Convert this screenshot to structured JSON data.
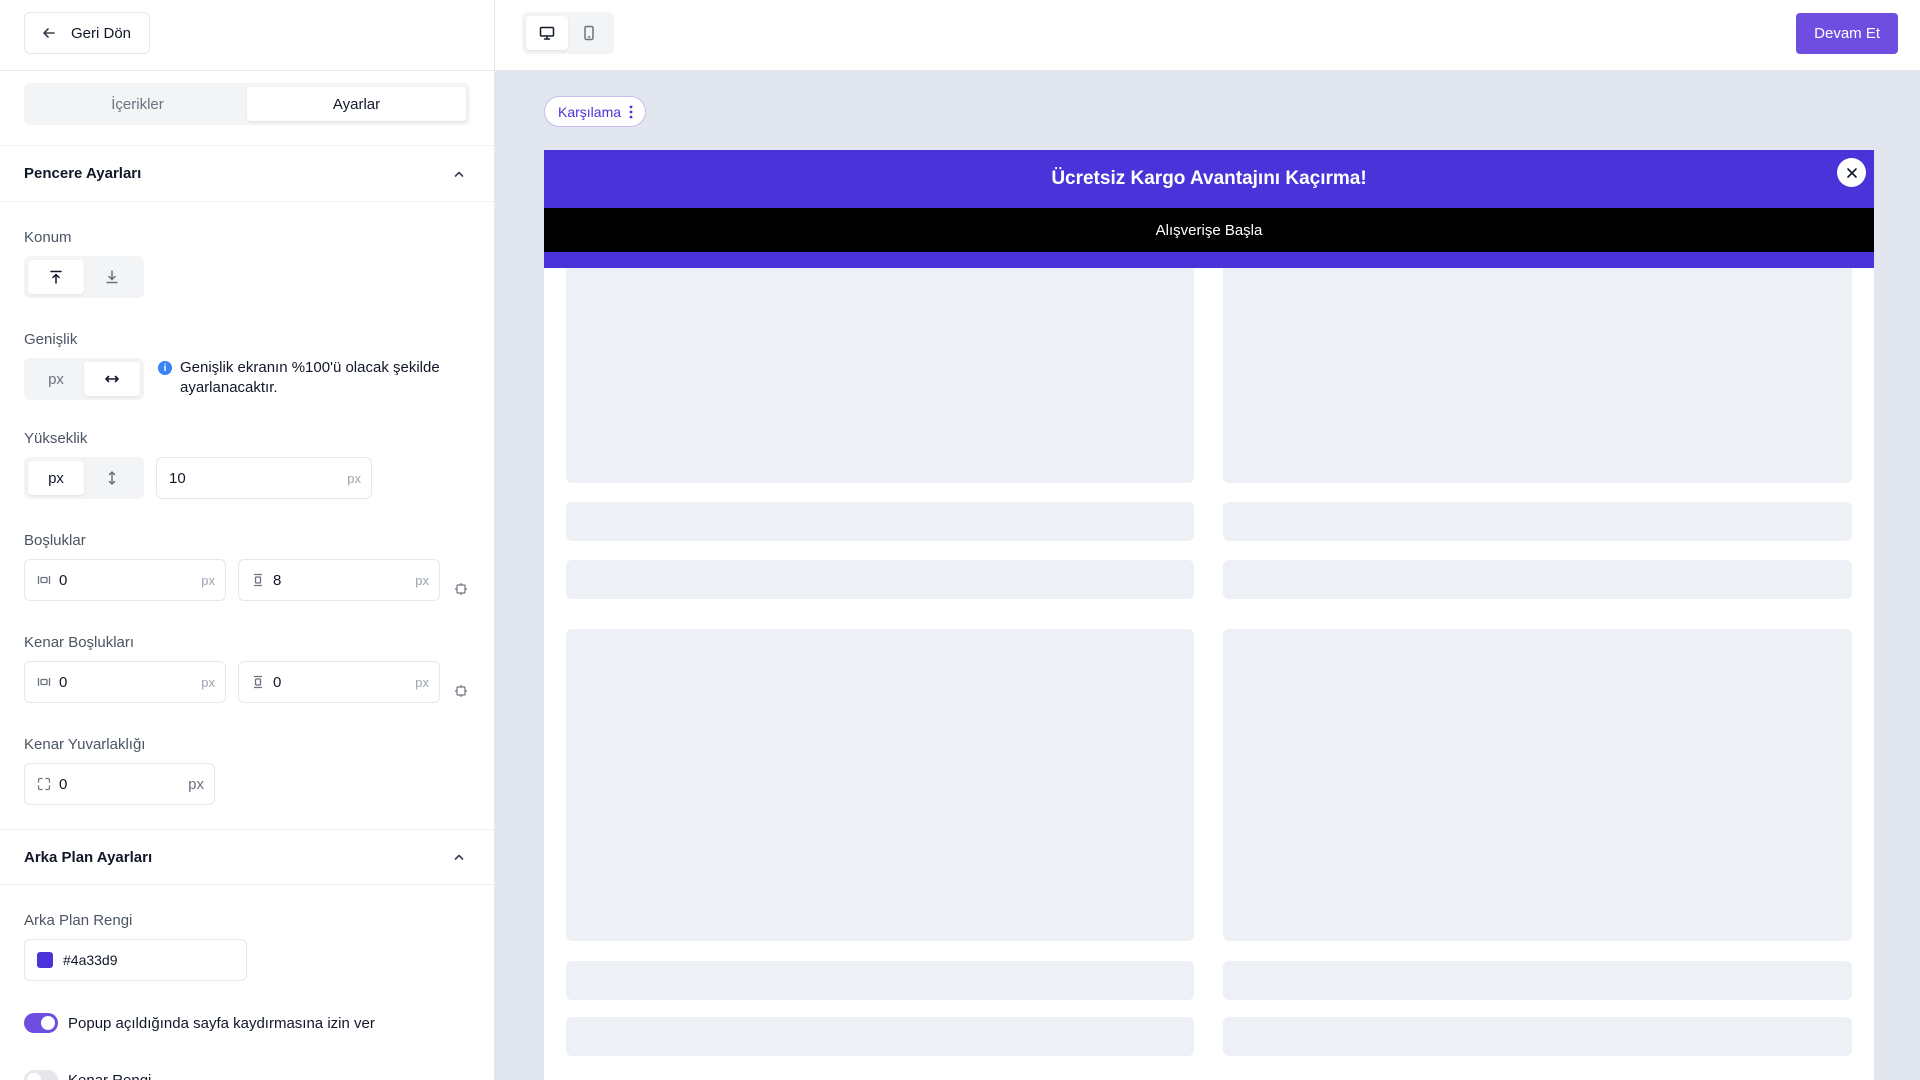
{
  "sidebar": {
    "back_label": "Geri Dön",
    "tabs": [
      {
        "label": "İçerikler",
        "active": false
      },
      {
        "label": "Ayarlar",
        "active": true
      }
    ],
    "window_settings": {
      "title": "Pencere Ayarları",
      "position": {
        "label": "Konum",
        "options": [
          "align-top-icon",
          "align-bottom-icon"
        ],
        "selected": 0
      },
      "width": {
        "label": "Genişlik",
        "options": [
          "px",
          "full-width-icon"
        ],
        "selected": 1,
        "info": "Genişlik ekranın %100'ü olacak şekilde ayarlanacaktır."
      },
      "height": {
        "label": "Yükseklik",
        "options": [
          "px",
          "auto-height-icon"
        ],
        "selected": 0,
        "value": "10",
        "unit": "px"
      },
      "padding": {
        "label": "Boşluklar",
        "horizontal": "0",
        "vertical": "8",
        "unit": "px"
      },
      "margin": {
        "label": "Kenar Boşlukları",
        "horizontal": "0",
        "vertical": "0",
        "unit": "px"
      },
      "radius": {
        "label": "Kenar Yuvarlaklığı",
        "value": "0",
        "unit": "px"
      }
    },
    "background_settings": {
      "title": "Arka Plan Ayarları",
      "color_label": "Arka Plan Rengi",
      "color_value": "#4a33d9",
      "allow_scroll_label": "Popup açıldığında sayfa kaydırmasına izin ver",
      "allow_scroll_on": true,
      "border_color_label": "Kenar Rengi",
      "border_color_on": false
    }
  },
  "topbar": {
    "devices": [
      "desktop-icon",
      "mobile-icon"
    ],
    "selected_device": 0,
    "continue_label": "Devam Et"
  },
  "canvas": {
    "step_label": "Karşılama",
    "banner": {
      "title": "Ücretsiz Kargo Avantajını Kaçırma!",
      "button_label": "Alışverişe Başla",
      "background": "#4a33d9"
    }
  },
  "colors": {
    "accent": "#6d4ee0",
    "brand": "#4a33d9"
  }
}
